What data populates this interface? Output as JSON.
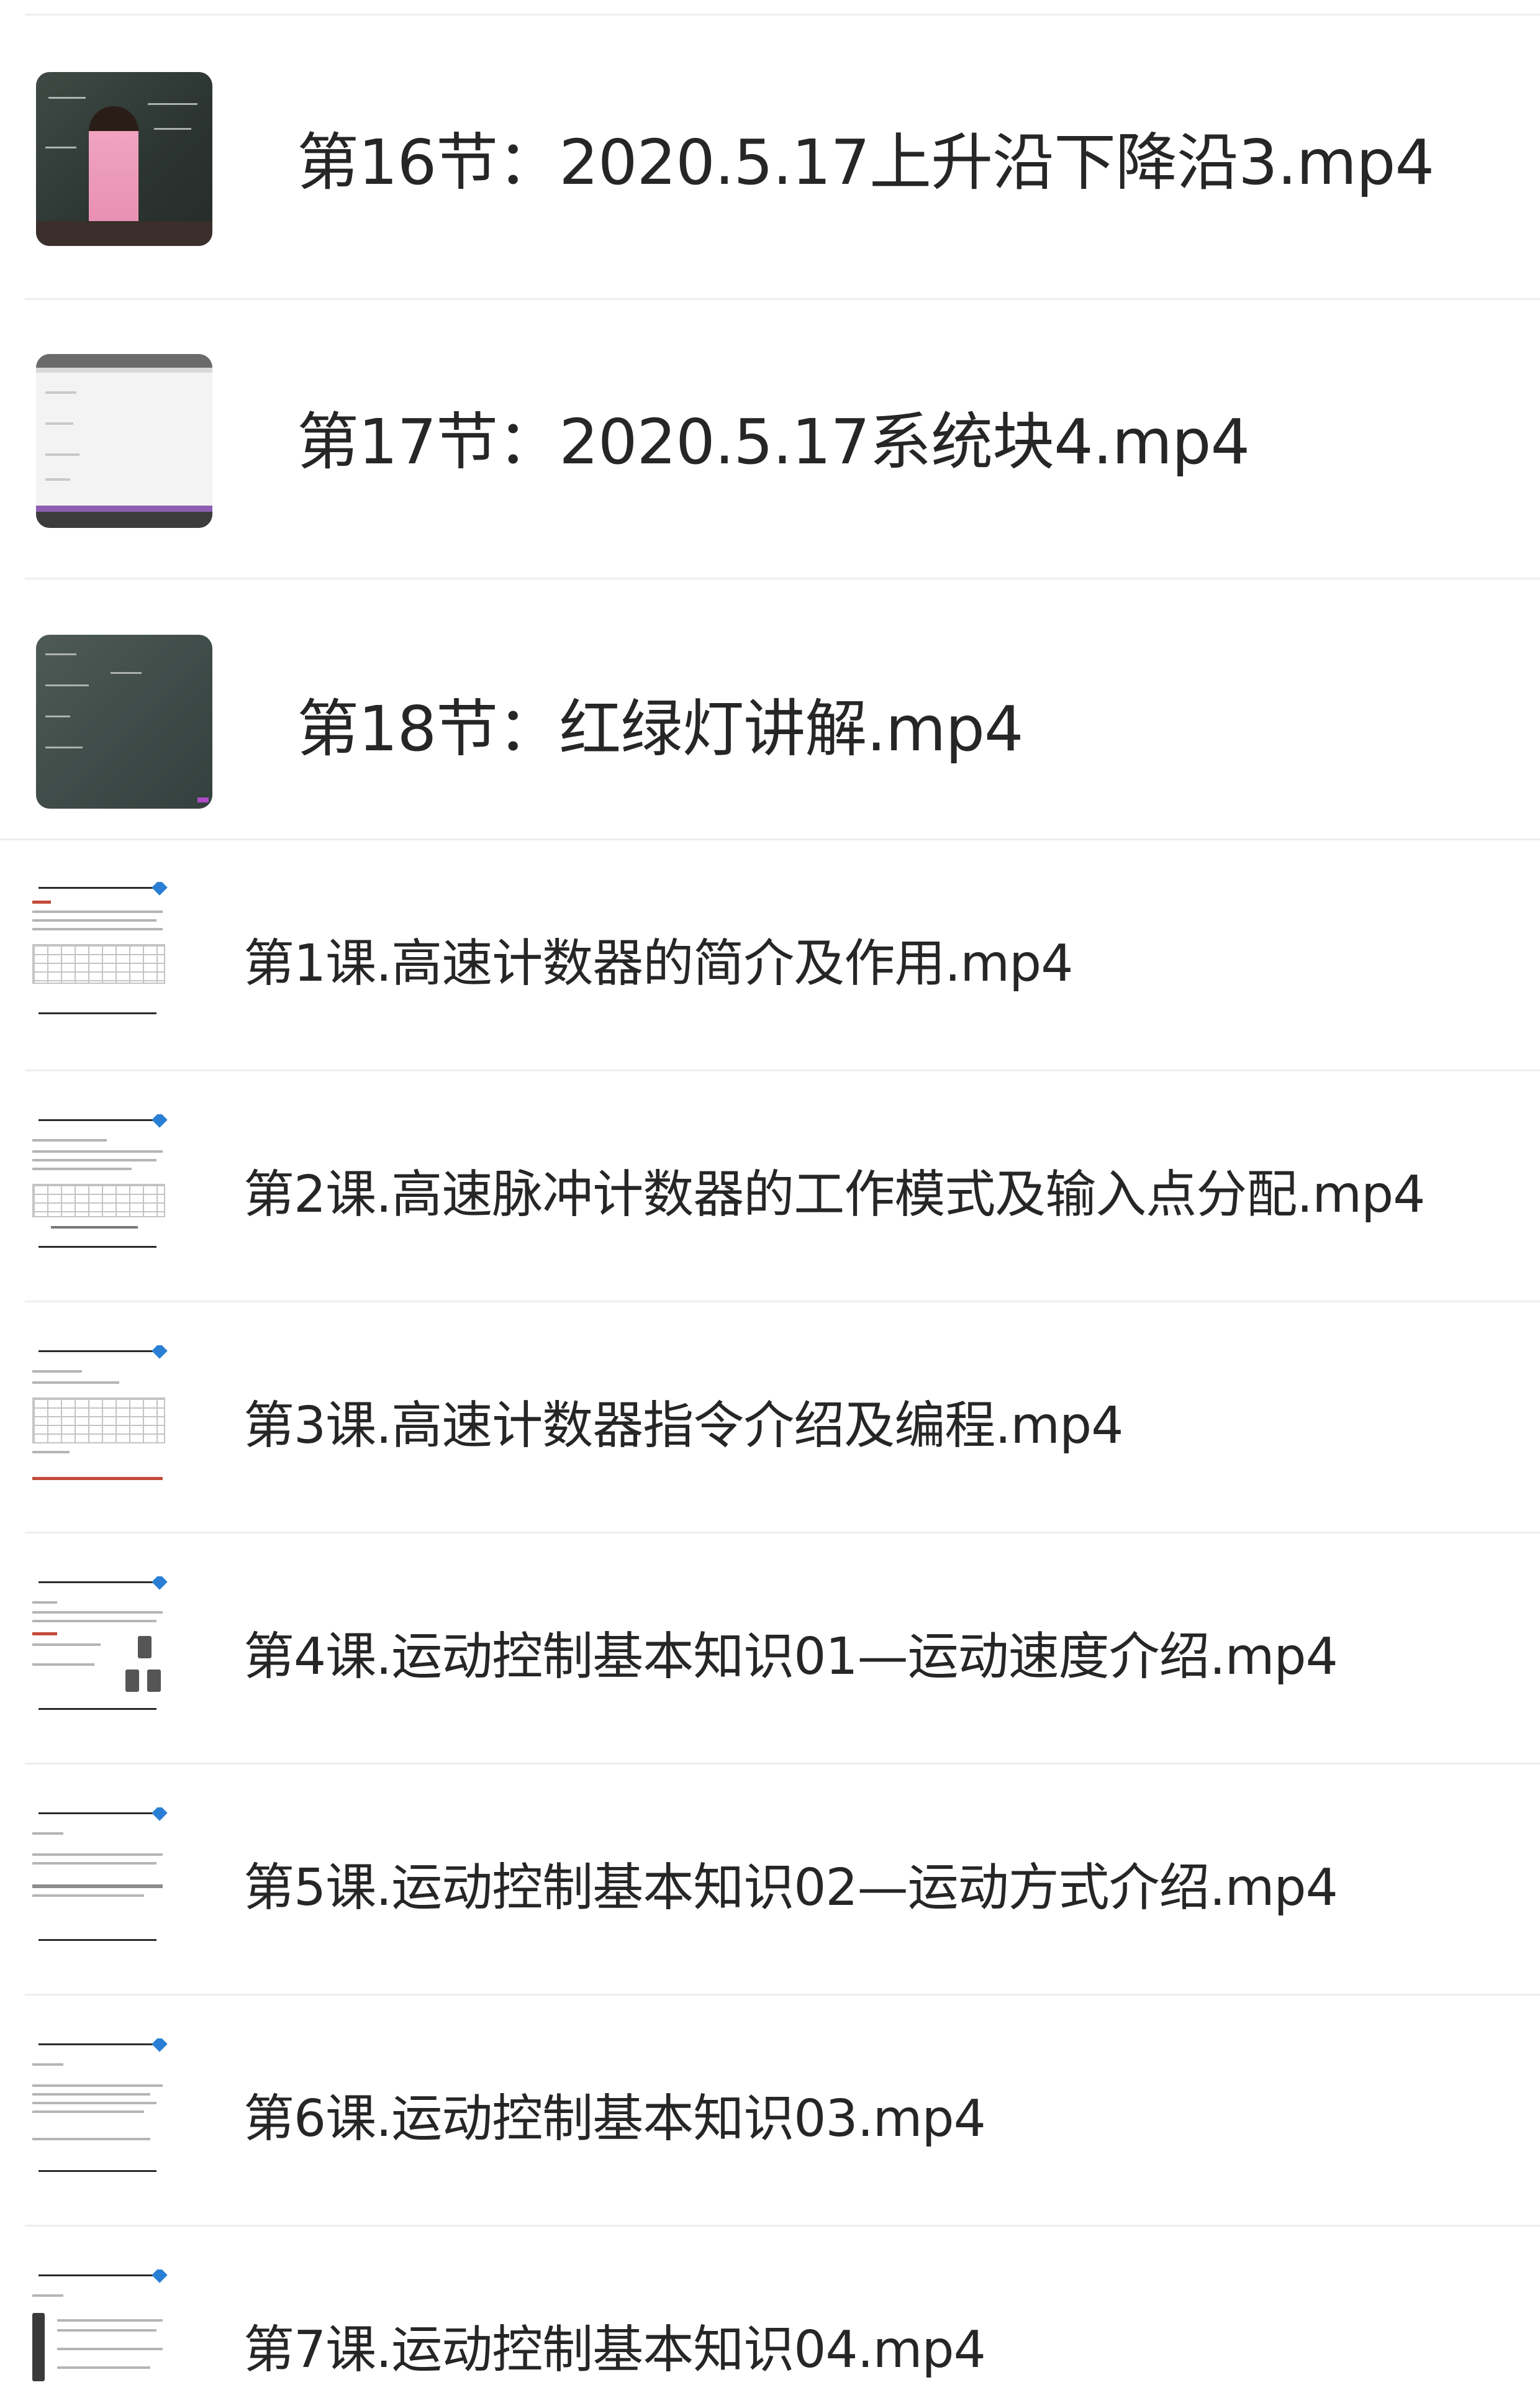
{
  "list": {
    "items": [
      {
        "type": "section",
        "thumbnail": "teacher-at-blackboard-thumbnail",
        "title": "第16节：2020.5.17上升沿下降沿3.mp4"
      },
      {
        "type": "section",
        "thumbnail": "software-screen-thumbnail",
        "title": "第17节：2020.5.17系统块4.mp4"
      },
      {
        "type": "section",
        "thumbnail": "blackboard-thumbnail",
        "title": "第18节：红绿灯讲解.mp4"
      },
      {
        "type": "lesson",
        "thumbnail": "document-slide-thumbnail",
        "title": "第1课.高速计数器的简介及作用.mp4"
      },
      {
        "type": "lesson",
        "thumbnail": "document-slide-thumbnail",
        "title": "第2课.高速脉冲计数器的工作模式及输入点分配.mp4"
      },
      {
        "type": "lesson",
        "thumbnail": "document-slide-thumbnail",
        "title": "第3课.高速计数器指令介绍及编程.mp4"
      },
      {
        "type": "lesson",
        "thumbnail": "document-slide-thumbnail",
        "title": "第4课.运动控制基本知识01—运动速度介绍.mp4"
      },
      {
        "type": "lesson",
        "thumbnail": "document-slide-thumbnail",
        "title": "第5课.运动控制基本知识02—运动方式介绍.mp4"
      },
      {
        "type": "lesson",
        "thumbnail": "document-slide-thumbnail",
        "title": "第6课.运动控制基本知识03.mp4"
      },
      {
        "type": "lesson",
        "thumbnail": "document-slide-thumbnail",
        "title": "第7课.运动控制基本知识04.mp4"
      }
    ]
  },
  "colors": {
    "background": "#ffffff",
    "text": "#262626",
    "separator": "#eceef1",
    "accent_icon": "#2a7fd4"
  }
}
